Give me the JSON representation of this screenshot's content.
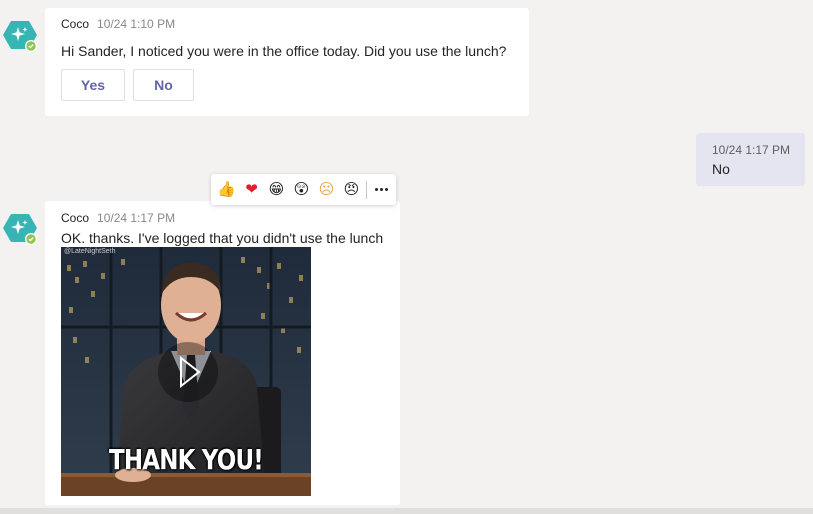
{
  "messages": [
    {
      "sender": "Coco",
      "time": "10/24 1:10 PM",
      "text": "Hi Sander, I noticed you were in the office today. Did you use the lunch?",
      "buttons": [
        "Yes",
        "No"
      ]
    },
    {
      "time": "10/24 1:17 PM",
      "text": "No"
    },
    {
      "sender": "Coco",
      "time": "10/24 1:17 PM",
      "text": "OK. thanks. I've logged that you didn't use the lunch",
      "gif": {
        "watermark": "@LateNightSeth",
        "caption": "THANK YOU!"
      }
    }
  ],
  "reactions": [
    {
      "icon": "like-icon",
      "glyph": "👍"
    },
    {
      "icon": "heart-icon",
      "glyph": "❤"
    },
    {
      "icon": "laugh-icon",
      "glyph": "😁"
    },
    {
      "icon": "surprised-icon",
      "glyph": "😲"
    },
    {
      "icon": "sad-icon",
      "glyph": "☹"
    },
    {
      "icon": "angry-icon",
      "glyph": "😠"
    }
  ],
  "colors": {
    "accent": "#6264a7",
    "bot_avatar": "#37b5b4",
    "online_badge": "#92c353",
    "my_bubble": "#e5e5f1",
    "background": "#f3f2f1"
  }
}
